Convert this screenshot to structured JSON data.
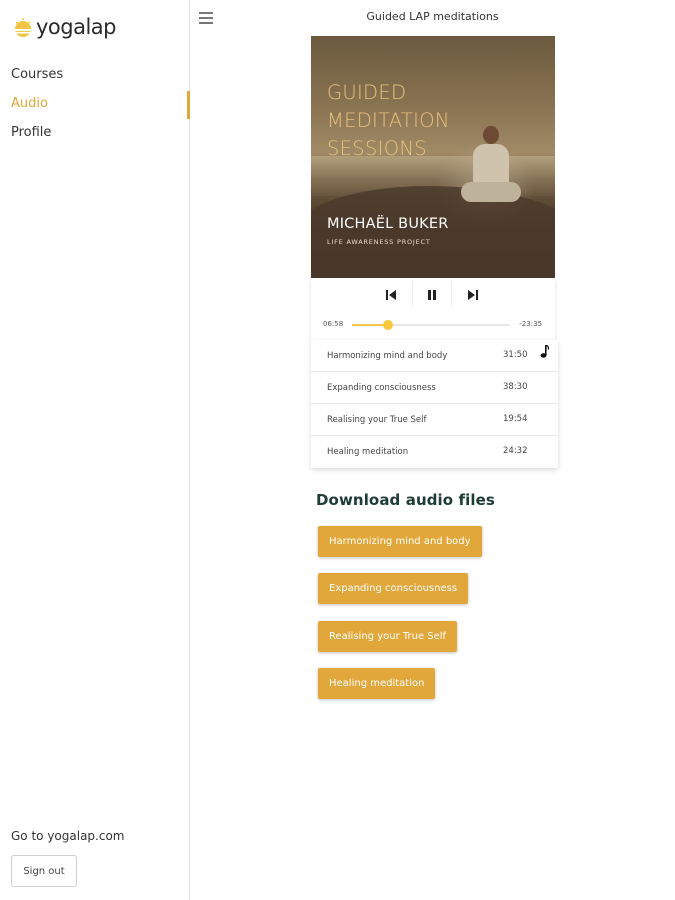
{
  "brand": {
    "name": "yogalap",
    "accent": "#e1a73a"
  },
  "sidebar": {
    "items": [
      {
        "label": "Courses",
        "active": false
      },
      {
        "label": "Audio",
        "active": true
      },
      {
        "label": "Profile",
        "active": false
      }
    ],
    "goto_link": "Go to yogalap.com",
    "signout_label": "Sign out"
  },
  "header": {
    "title": "Guided LAP meditations",
    "menu_icon": "hamburger-menu-icon"
  },
  "player": {
    "cover": {
      "title_lines": [
        "GUIDED",
        "MEDITATION",
        "SESSIONS"
      ],
      "author": "MICHAËL BUKER",
      "subtitle": "LIFE AWARENESS PROJECT"
    },
    "controls": {
      "prev_icon": "skip-previous-icon",
      "pause_icon": "pause-icon",
      "next_icon": "skip-next-icon"
    },
    "elapsed": "06:58",
    "remaining": "-23:35",
    "progress_fraction": 0.23
  },
  "tracks": [
    {
      "title": "Harmonizing mind and body",
      "duration": "31:50",
      "playing": true
    },
    {
      "title": "Expanding consciousness",
      "duration": "38:30",
      "playing": false
    },
    {
      "title": "Realising your True Self",
      "duration": "19:54",
      "playing": false
    },
    {
      "title": "Healing meditation",
      "duration": "24:32",
      "playing": false
    }
  ],
  "downloads": {
    "heading": "Download audio files",
    "buttons": [
      "Harmonizing mind and body",
      "Expanding consciousness",
      "Realising your True Self",
      "Healing meditation"
    ]
  }
}
